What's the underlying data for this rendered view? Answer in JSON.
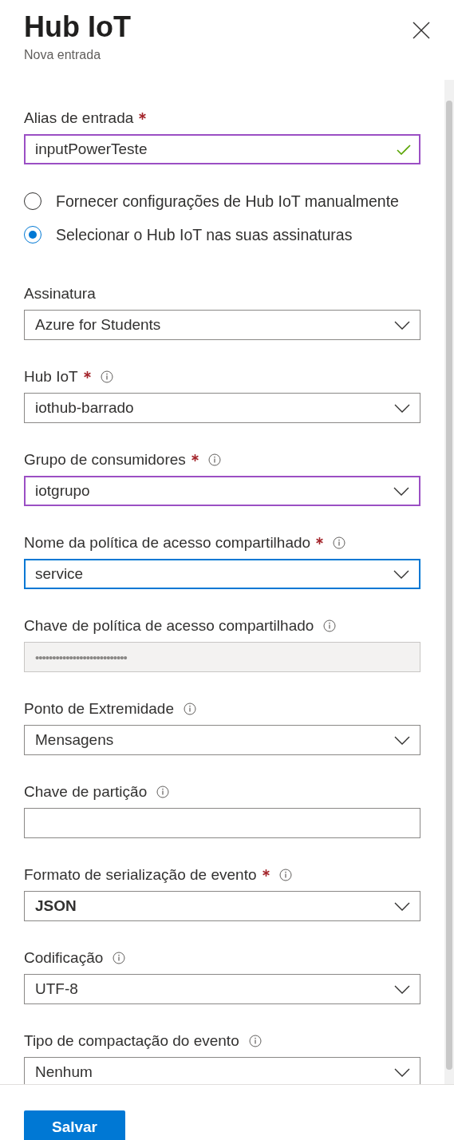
{
  "header": {
    "title": "Hub IoT",
    "subtitle": "Nova entrada"
  },
  "alias_field": {
    "kind": "text",
    "label": "Alias de entrada",
    "required": true,
    "info": false,
    "value": "inputPowerTeste",
    "valid": true,
    "focused": false,
    "modified": true,
    "bold": false
  },
  "source_options": [
    {
      "label": "Fornecer configurações de Hub IoT manualmente",
      "selected": false
    },
    {
      "label": "Selecionar o Hub IoT nas suas assinaturas",
      "selected": true
    }
  ],
  "fields": [
    {
      "kind": "dropdown",
      "label": "Assinatura",
      "required": false,
      "info": false,
      "value": "Azure for Students",
      "focused": false,
      "modified": false,
      "bold": false
    },
    {
      "kind": "dropdown",
      "label": "Hub IoT",
      "required": true,
      "info": true,
      "value": "iothub-barrado",
      "focused": false,
      "modified": false,
      "bold": false
    },
    {
      "kind": "dropdown",
      "label": "Grupo de consumidores",
      "required": true,
      "info": true,
      "value": "iotgrupo",
      "focused": false,
      "modified": true,
      "bold": false
    },
    {
      "kind": "dropdown",
      "label": "Nome da política de acesso compartilhado",
      "required": true,
      "info": true,
      "value": "service",
      "focused": true,
      "modified": false,
      "bold": false
    },
    {
      "kind": "masked",
      "label": "Chave de política de acesso compartilhado",
      "required": false,
      "info": true,
      "value": "•••••••••••••••••••••••••••",
      "focused": false,
      "modified": false,
      "bold": false
    },
    {
      "kind": "dropdown",
      "label": "Ponto de Extremidade",
      "required": false,
      "info": true,
      "value": "Mensagens",
      "focused": false,
      "modified": false,
      "bold": false
    },
    {
      "kind": "text",
      "label": "Chave de partição",
      "required": false,
      "info": true,
      "valid": false,
      "focused": false,
      "modified": false,
      "bold": false
    },
    {
      "kind": "dropdown",
      "label": "Formato de serialização de evento",
      "required": true,
      "info": true,
      "value": "JSON",
      "focused": false,
      "modified": false,
      "bold": true
    },
    {
      "kind": "dropdown",
      "label": "Codificação",
      "required": false,
      "info": true,
      "value": "UTF-8",
      "focused": false,
      "modified": false,
      "bold": false
    },
    {
      "kind": "dropdown",
      "label": "Tipo de compactação do evento",
      "required": false,
      "info": true,
      "value": "Nenhum",
      "focused": false,
      "modified": false,
      "bold": false
    }
  ],
  "footer": {
    "save_button": "Salvar"
  }
}
